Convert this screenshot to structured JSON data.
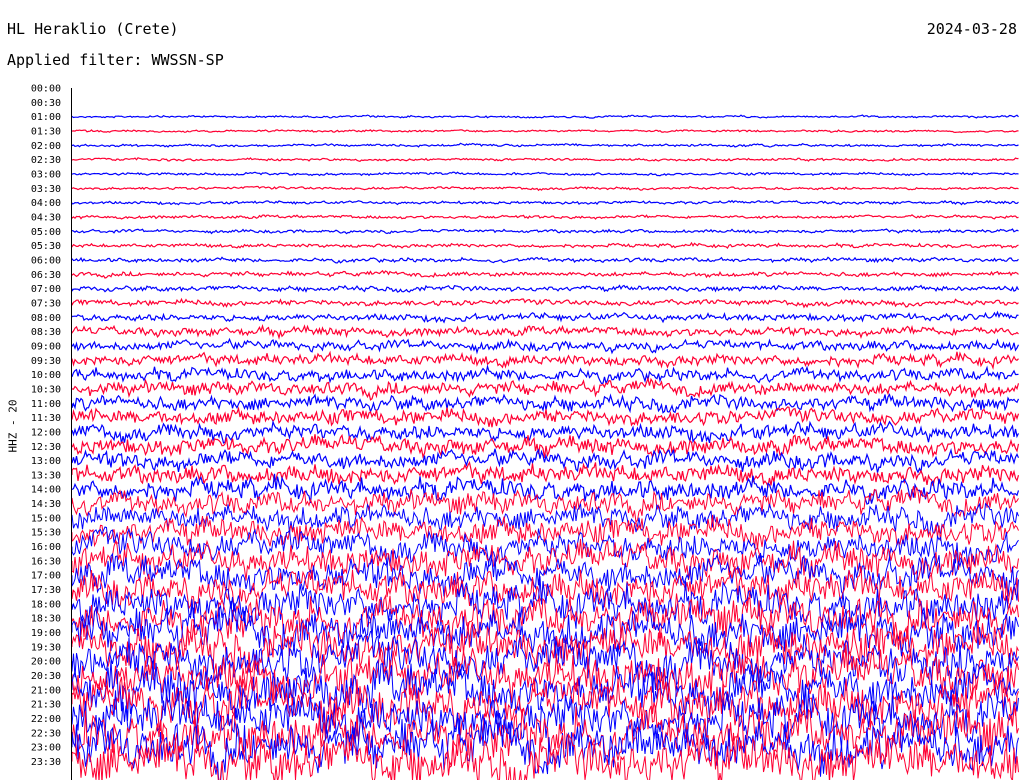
{
  "header": {
    "station": "HL Heraklio (Crete)",
    "date": "2024-03-28",
    "filter": "Applied filter: WWSSN-SP"
  },
  "channel_label": "HHZ - 20",
  "colors": {
    "even_trace": "#0000ff",
    "odd_trace": "#ff0033",
    "axis": "#000000"
  },
  "chart_data": {
    "type": "line",
    "title": "HL Heraklio (Crete)",
    "subtitle": "Applied filter: WWSSN-SP",
    "ylabel": "HHZ - 20",
    "xlabel": "",
    "row_labels": [
      "00:00",
      "00:30",
      "01:00",
      "01:30",
      "02:00",
      "02:30",
      "03:00",
      "03:30",
      "04:00",
      "04:30",
      "05:00",
      "05:30",
      "06:00",
      "06:30",
      "07:00",
      "07:30",
      "08:00",
      "08:30",
      "09:00",
      "09:30",
      "10:00",
      "10:30",
      "11:00",
      "11:30",
      "12:00",
      "12:30",
      "13:00",
      "13:30",
      "14:00",
      "14:30",
      "15:00",
      "15:30",
      "16:00",
      "16:30",
      "17:00",
      "17:30",
      "18:00",
      "18:30",
      "19:00",
      "19:30",
      "20:00",
      "20:30",
      "21:00",
      "21:30",
      "22:00",
      "22:30",
      "23:00",
      "23:30"
    ],
    "first_trace_row": "01:00",
    "row_minutes": 30,
    "relative_amplitude": [
      0,
      0,
      0.1,
      0.1,
      0.12,
      0.12,
      0.12,
      0.13,
      0.14,
      0.15,
      0.16,
      0.18,
      0.2,
      0.22,
      0.25,
      0.28,
      0.35,
      0.42,
      0.48,
      0.55,
      0.6,
      0.65,
      0.7,
      0.75,
      0.78,
      0.82,
      0.85,
      0.9,
      1.0,
      1.1,
      1.2,
      1.3,
      1.4,
      1.5,
      1.6,
      1.7,
      1.8,
      1.9,
      2.0,
      2.0,
      2.1,
      2.1,
      2.2,
      2.2,
      2.2,
      2.3,
      2.3,
      2.3
    ],
    "grid": false
  }
}
